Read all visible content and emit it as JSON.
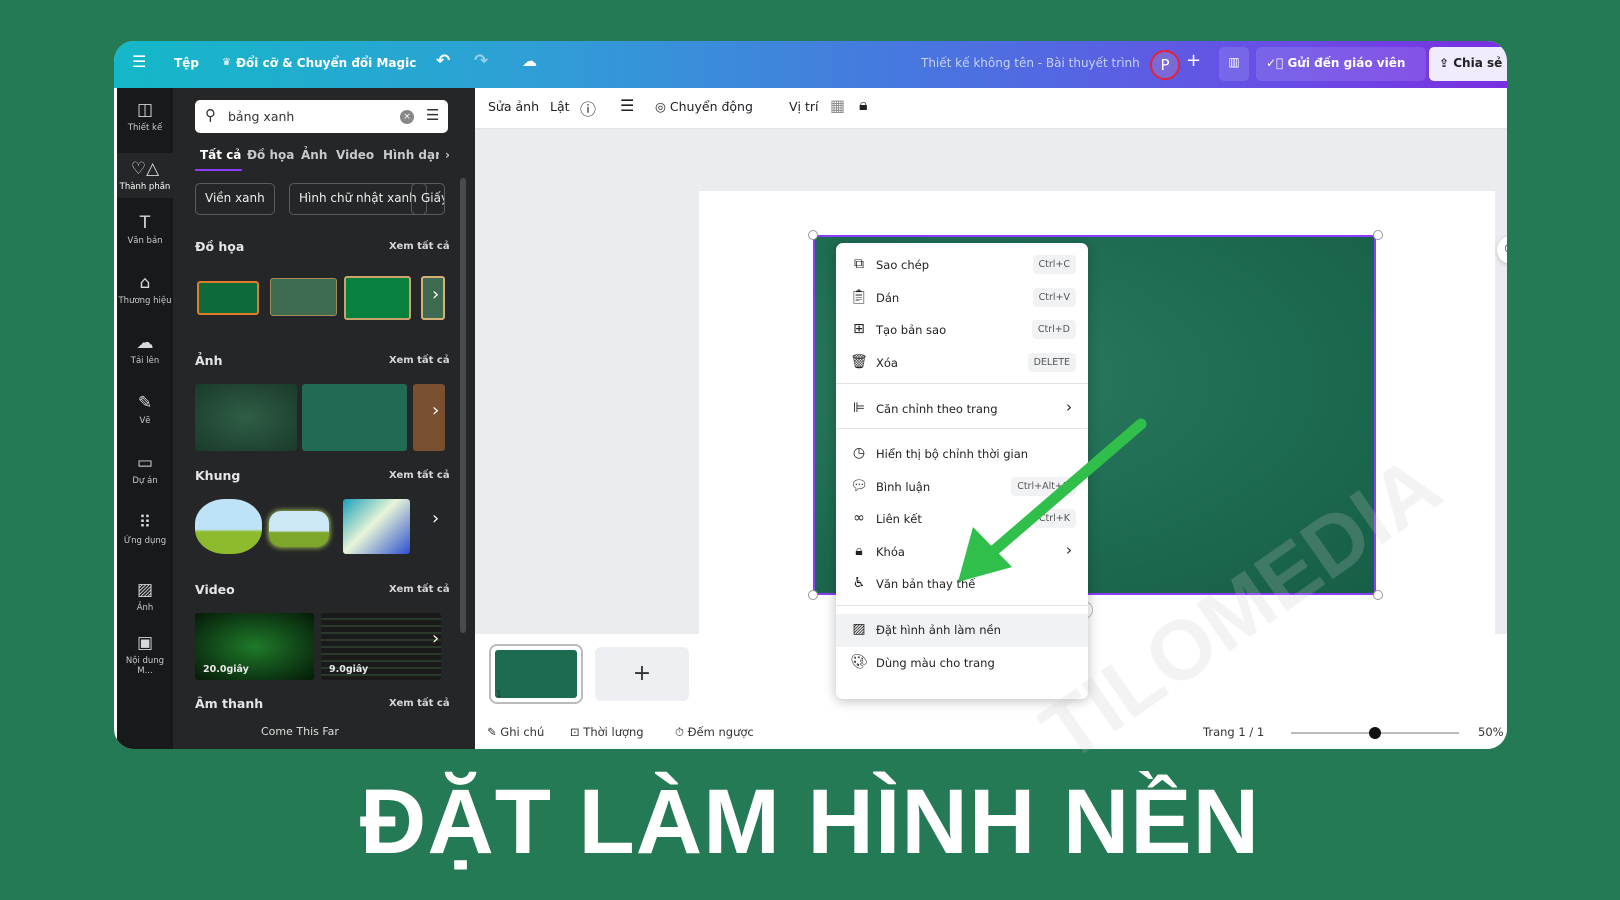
{
  "topbar": {
    "menu_icon": "hamburger-icon",
    "file": "Tệp",
    "magic_resize": "Đổi cỡ & Chuyển đổi Magic",
    "undo_icon": "undo-icon",
    "redo_icon": "redo-icon",
    "cloud_icon": "cloud-saved-icon",
    "title": "Thiết kế không tên - Bài thuyết trình",
    "avatar": "P",
    "add": "+",
    "send_teacher": "Gửi đến giáo viên",
    "share": "Chia sẻ"
  },
  "rail": {
    "items": [
      {
        "label": "Thiết kế",
        "icon": "layout-icon"
      },
      {
        "label": "Thành phần",
        "icon": "elements-icon"
      },
      {
        "label": "Văn bản",
        "icon": "text-icon"
      },
      {
        "label": "Thương hiệu",
        "icon": "brand-icon"
      },
      {
        "label": "Tải lên",
        "icon": "upload-icon"
      },
      {
        "label": "Vẽ",
        "icon": "draw-icon"
      },
      {
        "label": "Dự án",
        "icon": "folder-icon"
      },
      {
        "label": "Ứng dụng",
        "icon": "apps-icon"
      },
      {
        "label": "Ảnh",
        "icon": "photo-icon"
      },
      {
        "label": "Nội dung M...",
        "icon": "magic-media-icon"
      }
    ]
  },
  "panel": {
    "search_value": "bảng xanh",
    "tabs": [
      "Tất cả",
      "Đồ họa",
      "Ảnh",
      "Video",
      "Hình dạng"
    ],
    "chips": [
      "Viền xanh",
      "Hình chữ nhật xanh",
      "Giấy"
    ],
    "see_all": "Xem tất cả",
    "sections": {
      "graphics": "Đồ họa",
      "photos": "Ảnh",
      "frames": "Khung",
      "video": "Video",
      "audio": "Âm thanh"
    },
    "videos": [
      {
        "duration": "20.0giây"
      },
      {
        "duration": "9.0giây"
      }
    ],
    "audio_track": "Come This Far"
  },
  "toolbar": {
    "edit_image": "Sửa ảnh",
    "flip": "Lật",
    "animate": "Chuyển động",
    "position": "Vị trí"
  },
  "context_menu": {
    "items": [
      {
        "label": "Sao chép",
        "shortcut": "Ctrl+C",
        "icon": "copy-icon"
      },
      {
        "label": "Dán",
        "shortcut": "Ctrl+V",
        "icon": "paste-icon"
      },
      {
        "label": "Tạo bản sao",
        "shortcut": "Ctrl+D",
        "icon": "duplicate-icon"
      },
      {
        "label": "Xóa",
        "shortcut": "DELETE",
        "icon": "trash-icon"
      },
      {
        "label": "Căn chỉnh theo trang",
        "icon": "align-icon"
      },
      {
        "label": "Hiển thị bộ chỉnh thời gian",
        "icon": "clock-icon"
      },
      {
        "label": "Bình luận",
        "shortcut": "Ctrl+Alt+N",
        "icon": "comment-icon"
      },
      {
        "label": "Liên kết",
        "shortcut": "Ctrl+K",
        "icon": "link-icon"
      },
      {
        "label": "Khóa",
        "icon": "lock-icon"
      },
      {
        "label": "Văn bản thay thế",
        "icon": "accessibility-icon"
      },
      {
        "label": "Đặt hình ảnh làm nền",
        "icon": "background-icon"
      },
      {
        "label": "Dùng màu cho trang",
        "icon": "palette-icon"
      }
    ]
  },
  "pages": {
    "thumb_number": "1",
    "add": "+"
  },
  "bottom": {
    "notes": "Ghi chú",
    "duration": "Thời lượng",
    "timer": "Đếm ngược",
    "page_indicator": "Trang 1 / 1",
    "zoom": "50%",
    "zoom_level": 50
  },
  "headline": "ĐẶT LÀM HÌNH NỀN",
  "watermark": "TILOMEDIA",
  "colors": {
    "background": "#237a55",
    "arrow": "#2fbf4a",
    "selection": "#8b3dff",
    "board": "#1d6b51"
  }
}
